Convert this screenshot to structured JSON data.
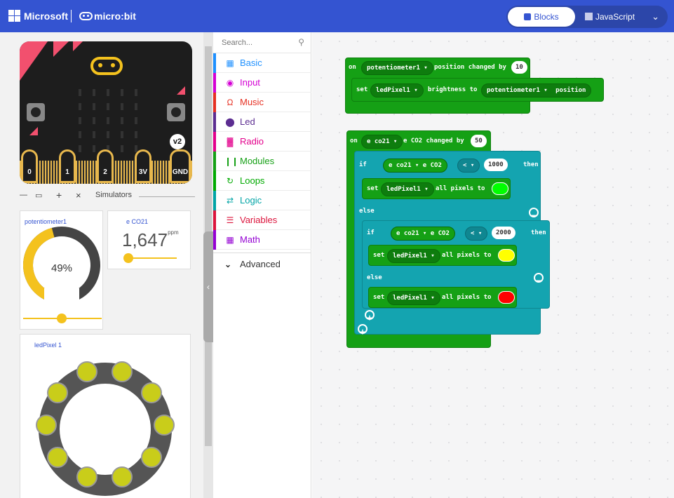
{
  "topbar": {
    "brand": "Microsoft",
    "product": "micro:bit",
    "blocks_label": "Blocks",
    "javascript_label": "JavaScript"
  },
  "board": {
    "badge": "v2",
    "pins": [
      "0",
      "1",
      "2",
      "3V",
      "GND"
    ]
  },
  "simulators": {
    "label": "Simulators",
    "potentiometer": {
      "title": "potentiometer1",
      "value": "49%",
      "level": 0.49
    },
    "co2": {
      "title": "e CO21",
      "value": "1,647",
      "unit": "ppm"
    },
    "ring": {
      "title": "ledPixel 1",
      "led_count": 10,
      "led_color": "#c9cd1a"
    }
  },
  "toolbox": {
    "search_placeholder": "Search...",
    "categories": [
      {
        "label": "Basic",
        "color": "#1e90ff",
        "icon": "grid-icon"
      },
      {
        "label": "Input",
        "color": "#d400d4",
        "icon": "target-icon"
      },
      {
        "label": "Music",
        "color": "#e63022",
        "icon": "headphones-icon"
      },
      {
        "label": "Led",
        "color": "#5c2d91",
        "icon": "toggle-icon"
      },
      {
        "label": "Radio",
        "color": "#e3008c",
        "icon": "signal-icon"
      },
      {
        "label": "Modules",
        "color": "#15a015",
        "icon": "bars-icon"
      },
      {
        "label": "Loops",
        "color": "#00aa00",
        "icon": "loop-icon"
      },
      {
        "label": "Logic",
        "color": "#00a4a6",
        "icon": "shuffle-icon"
      },
      {
        "label": "Variables",
        "color": "#dc143c",
        "icon": "lines-icon"
      },
      {
        "label": "Math",
        "color": "#9400d3",
        "icon": "calculator-icon"
      }
    ],
    "advanced_label": "Advanced"
  },
  "workspace": {
    "event1": {
      "on": "on",
      "sensor": "potentiometer1",
      "text": "position changed by",
      "value": "10",
      "set": "set",
      "pixel": "ledPixel1",
      "prop": "brightness to",
      "src_sensor": "potentiometer1",
      "src_prop": "position"
    },
    "event2": {
      "on": "on",
      "sensor": "e co21",
      "text": "e CO2 changed by",
      "value": "50",
      "if": "if",
      "cond_sensor": "e co21",
      "cond_prop": "e CO2",
      "op": "<",
      "v1": "1000",
      "then": "then",
      "set": "set",
      "pixel": "ledPixel1",
      "allpix": "all pixels to",
      "else": "else",
      "v2": "2000",
      "c_green": "#00ff00",
      "c_yellow": "#ffff00",
      "c_red": "#ff0000"
    }
  }
}
